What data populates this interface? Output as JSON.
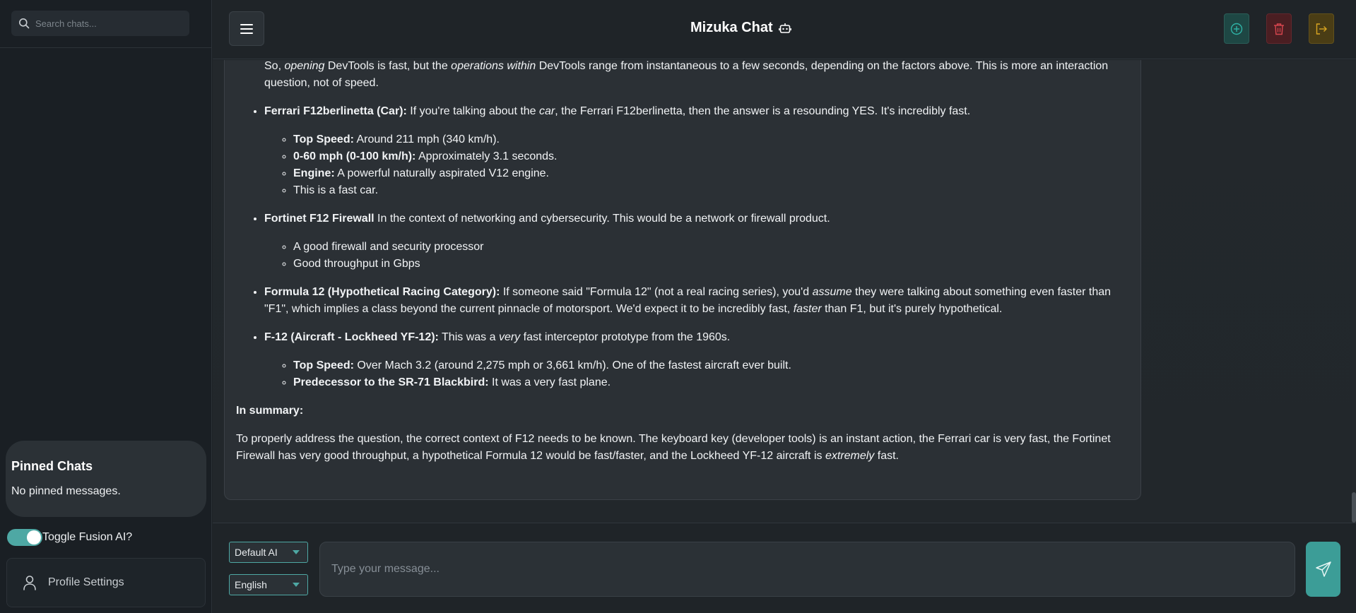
{
  "sidebar": {
    "search_placeholder": "Search chats...",
    "pinned_title": "Pinned Chats",
    "pinned_empty": "No pinned messages.",
    "fusion_toggle_label": "Toggle Fusion AI?",
    "fusion_toggle_on": true,
    "profile_label": "Profile Settings"
  },
  "header": {
    "title": "Mizuka Chat",
    "title_icon": "robot-icon",
    "menu_icon": "hamburger-menu-icon",
    "actions": [
      {
        "name": "new-chat-button",
        "icon": "plus-circle-icon",
        "color": "#2fb3a6"
      },
      {
        "name": "delete-chat-button",
        "icon": "trash-icon",
        "color": "#d9464f"
      },
      {
        "name": "logout-button",
        "icon": "logout-icon",
        "color": "#d9a521"
      }
    ]
  },
  "message": {
    "intro_prefix": "So, ",
    "intro_em1": "opening",
    "intro_mid1": " DevTools is fast, but the ",
    "intro_em2": "operations within",
    "intro_rest1": " DevTools range from instantaneous to a few seconds, depending on the factors above. This is more an interaction",
    "intro_line2": "question, not of speed.",
    "ferrari": {
      "title": "Ferrari F12berlinetta (Car):",
      "text_a": " If you're talking about the ",
      "text_em": "car",
      "text_b": ", the Ferrari F12berlinetta, then the answer is a resounding YES. It's incredibly fast.",
      "items": [
        {
          "label": "Top Speed:",
          "text": " Around 211 mph (340 km/h)."
        },
        {
          "label": "0-60 mph (0-100 km/h):",
          "text": " Approximately 3.1 seconds."
        },
        {
          "label": "Engine:",
          "text": " A powerful naturally aspirated V12 engine."
        },
        {
          "label": "",
          "text": "This is a fast car."
        }
      ]
    },
    "fortinet": {
      "title": "Fortinet F12 Firewall",
      "text": " In the context of networking and cybersecurity. This would be a network or firewall product.",
      "items": [
        "A good firewall and security processor",
        "Good throughput in Gbps"
      ]
    },
    "formula": {
      "title": "Formula 12 (Hypothetical Racing Category):",
      "text_a": " If someone said \"Formula 12\" (not a real racing series), you'd ",
      "text_em": "assume",
      "text_b": " they were talking about something even faster than",
      "line2_a": "\"F1\", which implies a class beyond the current pinnacle of motorsport. We'd expect it to be incredibly fast, ",
      "line2_em": "faster",
      "line2_b": " than F1, but it's purely hypothetical."
    },
    "aircraft": {
      "title": "F-12 (Aircraft - Lockheed YF-12):",
      "text_a": " This was a ",
      "text_em": "very",
      "text_b": " fast interceptor prototype from the 1960s.",
      "items": [
        {
          "label": "Top Speed:",
          "text": " Over Mach 3.2 (around 2,275 mph or 3,661 km/h). One of the fastest aircraft ever built."
        },
        {
          "label": "Predecessor to the SR-71 Blackbird:",
          "text": " It was a very fast plane."
        }
      ]
    },
    "summary_heading": "In summary:",
    "summary_line1": "To properly address the question, the correct context of F12 needs to be known. The keyboard key (developer tools) is an instant action, the Ferrari car is very fast, the Fortinet",
    "summary_line2_a": "Firewall has very good throughput, a hypothetical Formula 12 would be fast/faster, and the Lockheed YF-12 aircraft is ",
    "summary_line2_em": "extremely",
    "summary_line2_b": " fast."
  },
  "footer": {
    "model_select": "Default AI",
    "language_select": "English",
    "message_placeholder": "Type your message...",
    "send_icon": "send-icon"
  },
  "colors": {
    "accent": "#4ea8a4",
    "background": "#1d2226",
    "bubble": "#2b3035"
  }
}
